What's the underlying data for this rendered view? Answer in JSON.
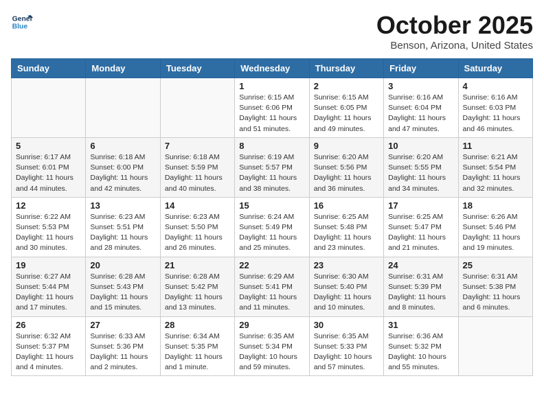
{
  "logo": {
    "line1": "General",
    "line2": "Blue"
  },
  "title": "October 2025",
  "location": "Benson, Arizona, United States",
  "days_of_week": [
    "Sunday",
    "Monday",
    "Tuesday",
    "Wednesday",
    "Thursday",
    "Friday",
    "Saturday"
  ],
  "weeks": [
    [
      {
        "day": "",
        "info": ""
      },
      {
        "day": "",
        "info": ""
      },
      {
        "day": "",
        "info": ""
      },
      {
        "day": "1",
        "info": "Sunrise: 6:15 AM\nSunset: 6:06 PM\nDaylight: 11 hours\nand 51 minutes."
      },
      {
        "day": "2",
        "info": "Sunrise: 6:15 AM\nSunset: 6:05 PM\nDaylight: 11 hours\nand 49 minutes."
      },
      {
        "day": "3",
        "info": "Sunrise: 6:16 AM\nSunset: 6:04 PM\nDaylight: 11 hours\nand 47 minutes."
      },
      {
        "day": "4",
        "info": "Sunrise: 6:16 AM\nSunset: 6:03 PM\nDaylight: 11 hours\nand 46 minutes."
      }
    ],
    [
      {
        "day": "5",
        "info": "Sunrise: 6:17 AM\nSunset: 6:01 PM\nDaylight: 11 hours\nand 44 minutes."
      },
      {
        "day": "6",
        "info": "Sunrise: 6:18 AM\nSunset: 6:00 PM\nDaylight: 11 hours\nand 42 minutes."
      },
      {
        "day": "7",
        "info": "Sunrise: 6:18 AM\nSunset: 5:59 PM\nDaylight: 11 hours\nand 40 minutes."
      },
      {
        "day": "8",
        "info": "Sunrise: 6:19 AM\nSunset: 5:57 PM\nDaylight: 11 hours\nand 38 minutes."
      },
      {
        "day": "9",
        "info": "Sunrise: 6:20 AM\nSunset: 5:56 PM\nDaylight: 11 hours\nand 36 minutes."
      },
      {
        "day": "10",
        "info": "Sunrise: 6:20 AM\nSunset: 5:55 PM\nDaylight: 11 hours\nand 34 minutes."
      },
      {
        "day": "11",
        "info": "Sunrise: 6:21 AM\nSunset: 5:54 PM\nDaylight: 11 hours\nand 32 minutes."
      }
    ],
    [
      {
        "day": "12",
        "info": "Sunrise: 6:22 AM\nSunset: 5:53 PM\nDaylight: 11 hours\nand 30 minutes."
      },
      {
        "day": "13",
        "info": "Sunrise: 6:23 AM\nSunset: 5:51 PM\nDaylight: 11 hours\nand 28 minutes."
      },
      {
        "day": "14",
        "info": "Sunrise: 6:23 AM\nSunset: 5:50 PM\nDaylight: 11 hours\nand 26 minutes."
      },
      {
        "day": "15",
        "info": "Sunrise: 6:24 AM\nSunset: 5:49 PM\nDaylight: 11 hours\nand 25 minutes."
      },
      {
        "day": "16",
        "info": "Sunrise: 6:25 AM\nSunset: 5:48 PM\nDaylight: 11 hours\nand 23 minutes."
      },
      {
        "day": "17",
        "info": "Sunrise: 6:25 AM\nSunset: 5:47 PM\nDaylight: 11 hours\nand 21 minutes."
      },
      {
        "day": "18",
        "info": "Sunrise: 6:26 AM\nSunset: 5:46 PM\nDaylight: 11 hours\nand 19 minutes."
      }
    ],
    [
      {
        "day": "19",
        "info": "Sunrise: 6:27 AM\nSunset: 5:44 PM\nDaylight: 11 hours\nand 17 minutes."
      },
      {
        "day": "20",
        "info": "Sunrise: 6:28 AM\nSunset: 5:43 PM\nDaylight: 11 hours\nand 15 minutes."
      },
      {
        "day": "21",
        "info": "Sunrise: 6:28 AM\nSunset: 5:42 PM\nDaylight: 11 hours\nand 13 minutes."
      },
      {
        "day": "22",
        "info": "Sunrise: 6:29 AM\nSunset: 5:41 PM\nDaylight: 11 hours\nand 11 minutes."
      },
      {
        "day": "23",
        "info": "Sunrise: 6:30 AM\nSunset: 5:40 PM\nDaylight: 11 hours\nand 10 minutes."
      },
      {
        "day": "24",
        "info": "Sunrise: 6:31 AM\nSunset: 5:39 PM\nDaylight: 11 hours\nand 8 minutes."
      },
      {
        "day": "25",
        "info": "Sunrise: 6:31 AM\nSunset: 5:38 PM\nDaylight: 11 hours\nand 6 minutes."
      }
    ],
    [
      {
        "day": "26",
        "info": "Sunrise: 6:32 AM\nSunset: 5:37 PM\nDaylight: 11 hours\nand 4 minutes."
      },
      {
        "day": "27",
        "info": "Sunrise: 6:33 AM\nSunset: 5:36 PM\nDaylight: 11 hours\nand 2 minutes."
      },
      {
        "day": "28",
        "info": "Sunrise: 6:34 AM\nSunset: 5:35 PM\nDaylight: 11 hours\nand 1 minute."
      },
      {
        "day": "29",
        "info": "Sunrise: 6:35 AM\nSunset: 5:34 PM\nDaylight: 10 hours\nand 59 minutes."
      },
      {
        "day": "30",
        "info": "Sunrise: 6:35 AM\nSunset: 5:33 PM\nDaylight: 10 hours\nand 57 minutes."
      },
      {
        "day": "31",
        "info": "Sunrise: 6:36 AM\nSunset: 5:32 PM\nDaylight: 10 hours\nand 55 minutes."
      },
      {
        "day": "",
        "info": ""
      }
    ]
  ]
}
